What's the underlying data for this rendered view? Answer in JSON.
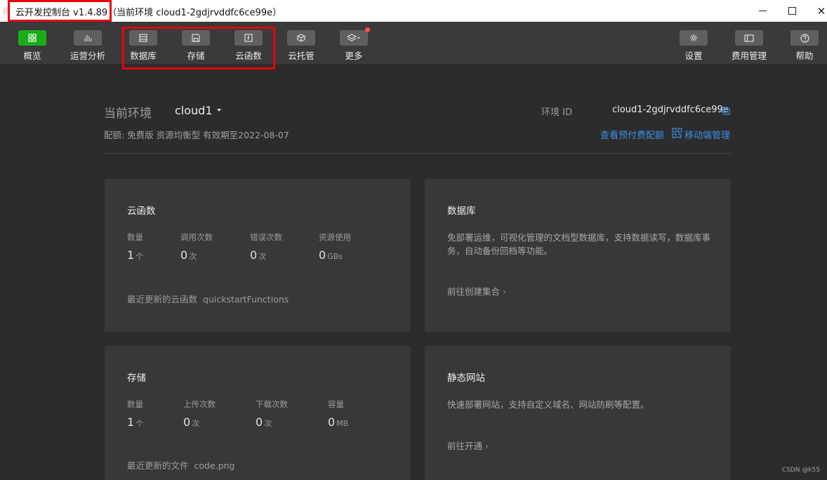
{
  "window": {
    "title": "云开发控制台 v1.4.89（当前环境 cloud1-2gdjrvddfc6ce99e）",
    "close_glyph": "✕"
  },
  "toolbar": {
    "left": [
      {
        "label": "概览",
        "icon": "grid-icon",
        "active": true
      },
      {
        "label": "运营分析",
        "icon": "bar-chart-icon",
        "active": false
      },
      {
        "label": "数据库",
        "icon": "database-icon",
        "active": false
      },
      {
        "label": "存储",
        "icon": "save-icon",
        "active": false
      },
      {
        "label": "云函数",
        "icon": "function-icon",
        "active": false
      },
      {
        "label": "云托管",
        "icon": "cube-icon",
        "active": false
      },
      {
        "label": "更多",
        "icon": "layers-icon",
        "active": false,
        "badge": true
      }
    ],
    "right": [
      {
        "label": "设置",
        "icon": "gear-icon"
      },
      {
        "label": "费用管理",
        "icon": "billing-icon"
      },
      {
        "label": "帮助",
        "icon": "help-icon"
      }
    ]
  },
  "env": {
    "label": "当前环境",
    "name": "cloud1",
    "id_label": "环境 ID",
    "id_value": "cloud1-2gdjrvddfc6ce99e",
    "quota": "配额: 免费版 资源均衡型 有效期至2022-08-07",
    "link_quota": "查看预付费配额",
    "link_mobile": "移动端管理"
  },
  "cards": {
    "functions": {
      "title": "云函数",
      "stats": [
        {
          "label": "数量",
          "value": "1",
          "unit": "个"
        },
        {
          "label": "调用次数",
          "value": "0",
          "unit": "次"
        },
        {
          "label": "错误次数",
          "value": "0",
          "unit": "次"
        },
        {
          "label": "资源使用",
          "value": "0",
          "unit": "GBs"
        }
      ],
      "recent_label": "最近更新的云函数",
      "recent_value": "quickstartFunctions"
    },
    "database": {
      "title": "数据库",
      "desc": "免部署运维，可视化管理的文档型数据库，支持数据读写，数据库事务，自动备份回档等功能。",
      "action": "前往创建集合"
    },
    "storage": {
      "title": "存储",
      "stats": [
        {
          "label": "数量",
          "value": "1",
          "unit": "个"
        },
        {
          "label": "上传次数",
          "value": "0",
          "unit": "次"
        },
        {
          "label": "下载次数",
          "value": "0",
          "unit": "次"
        },
        {
          "label": "容量",
          "value": "0",
          "unit": "MB"
        }
      ],
      "recent_label": "最近更新的文件",
      "recent_value": "code.png"
    },
    "static": {
      "title": "静态网站",
      "desc": "快速部署网站，支持自定义域名、网站防刷等配置。",
      "action": "前往开通"
    }
  },
  "chevron": "›",
  "watermark": "CSDN @k55",
  "colors": {
    "accent_green": "#1aad19",
    "link_blue": "#3b8fe5",
    "highlight_red": "#e8000b"
  }
}
